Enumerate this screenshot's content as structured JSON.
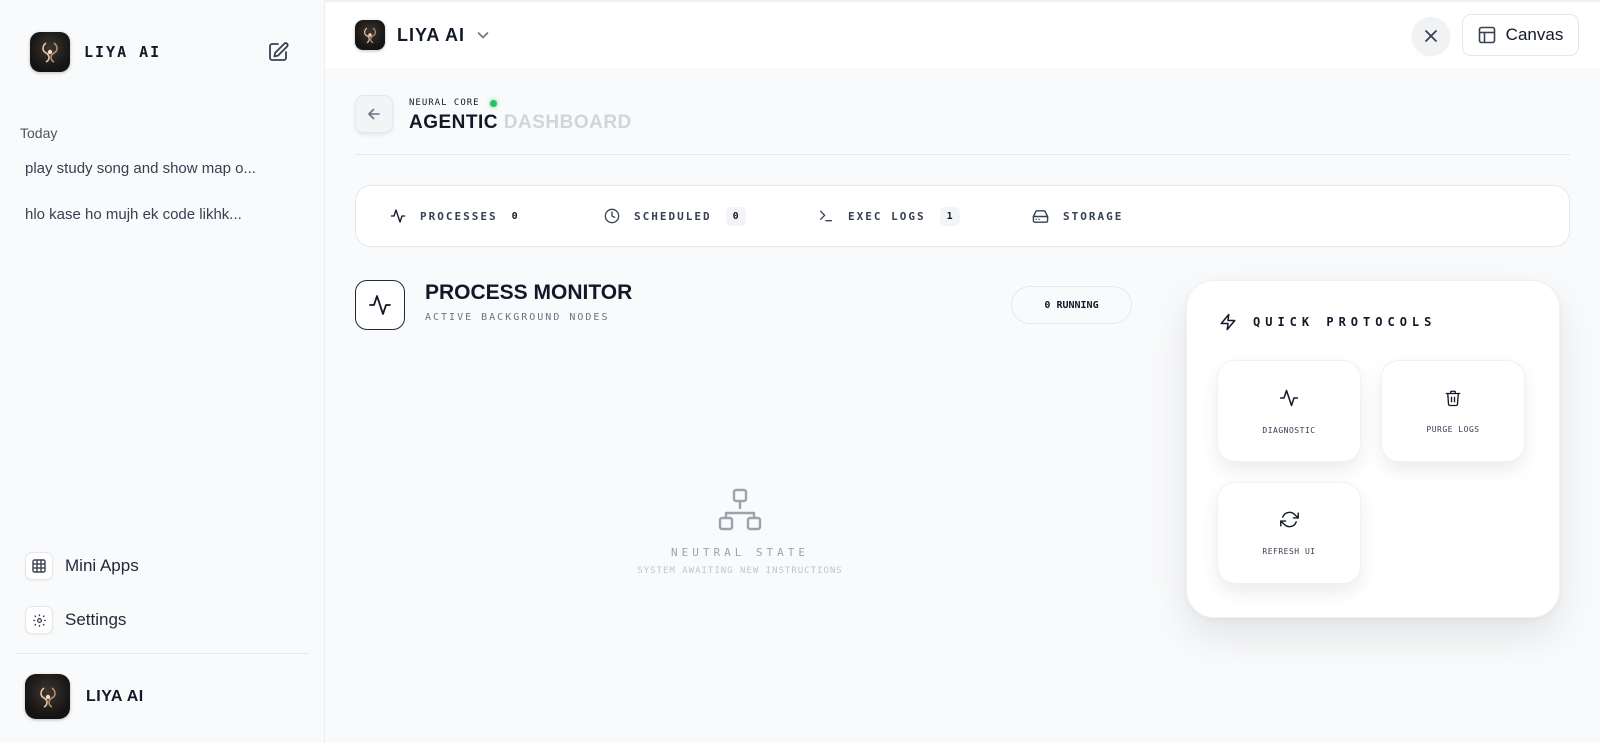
{
  "sidebar": {
    "brand": "LIYA AI",
    "section_label": "Today",
    "chats": [
      "play study song and show map o...",
      "hlo kase ho mujh ek code likhk..."
    ],
    "links": {
      "mini_apps": "Mini Apps",
      "settings": "Settings"
    },
    "user_name": "LIYA AI"
  },
  "topbar": {
    "brand": "LIYA AI",
    "canvas_label": "Canvas"
  },
  "header": {
    "eyebrow": "NEURAL CORE",
    "title_main": "AGENTIC",
    "title_faded": "DASHBOARD"
  },
  "tabs": [
    {
      "label": "PROCESSES",
      "count": "0",
      "icon": "activity-icon"
    },
    {
      "label": "SCHEDULED",
      "count": "0",
      "icon": "clock-icon"
    },
    {
      "label": "EXEC LOGS",
      "count": "1",
      "icon": "terminal-icon"
    },
    {
      "label": "STORAGE",
      "icon": "hard-drive-icon"
    }
  ],
  "process_monitor": {
    "title": "PROCESS MONITOR",
    "subtitle": "ACTIVE BACKGROUND NODES",
    "running": "0 RUNNING",
    "empty_title": "NEUTRAL STATE",
    "empty_subtitle": "SYSTEM AWAITING NEW INSTRUCTIONS"
  },
  "quick_protocols": {
    "title": "QUICK PROTOCOLS",
    "actions": [
      {
        "label": "DIAGNOSTIC",
        "icon": "activity-icon"
      },
      {
        "label": "PURGE LOGS",
        "icon": "trash-icon"
      },
      {
        "label": "REFRESH UI",
        "icon": "refresh-icon"
      }
    ]
  },
  "colors": {
    "status_online": "#22c55e",
    "text_primary": "#111827",
    "background": "#f9fafb"
  }
}
